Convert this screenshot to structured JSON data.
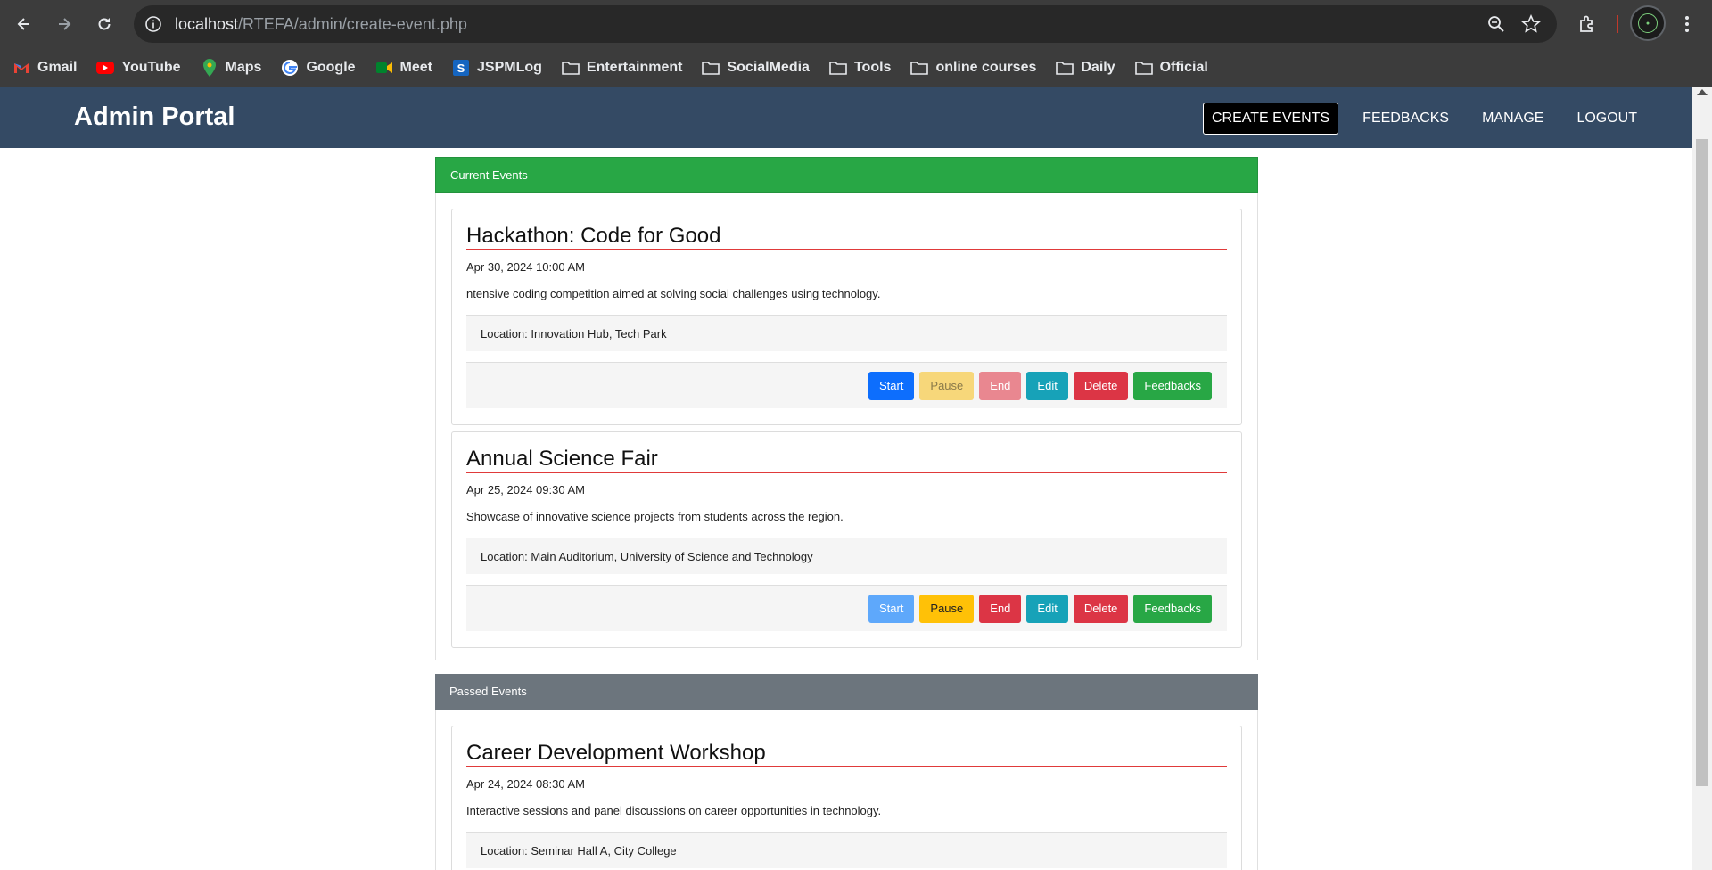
{
  "browser": {
    "url_host": "localhost",
    "url_path": "/RTEFA/admin/create-event.php",
    "bookmarks": [
      {
        "label": "Gmail",
        "icon": "gmail-icon"
      },
      {
        "label": "YouTube",
        "icon": "youtube-icon"
      },
      {
        "label": "Maps",
        "icon": "maps-icon"
      },
      {
        "label": "Google",
        "icon": "google-icon"
      },
      {
        "label": "Meet",
        "icon": "meet-icon"
      },
      {
        "label": "JSPMLog",
        "icon": "jspm-icon"
      },
      {
        "label": "Entertainment",
        "icon": "folder-icon"
      },
      {
        "label": "SocialMedia",
        "icon": "folder-icon"
      },
      {
        "label": "Tools",
        "icon": "folder-icon"
      },
      {
        "label": "online courses",
        "icon": "folder-icon"
      },
      {
        "label": "Daily",
        "icon": "folder-icon"
      },
      {
        "label": "Official",
        "icon": "folder-icon"
      }
    ]
  },
  "navbar": {
    "brand": "Admin Portal",
    "links": [
      "CREATE EVENTS",
      "FEEDBACKS",
      "MANAGE",
      "LOGOUT"
    ]
  },
  "current": {
    "header": "Current Events",
    "events": [
      {
        "title": "Hackathon: Code for Good",
        "date": "Apr 30, 2024 10:00 AM",
        "description": "ntensive coding competition aimed at solving social challenges using technology.",
        "location": "Location: Innovation Hub, Tech Park"
      },
      {
        "title": "Annual Science Fair",
        "date": "Apr 25, 2024 09:30 AM",
        "description": "Showcase of innovative science projects from students across the region.",
        "location": "Location: Main Auditorium, University of Science and Technology"
      }
    ]
  },
  "passed": {
    "header": "Passed Events",
    "events": [
      {
        "title": "Career Development Workshop",
        "date": "Apr 24, 2024 08:30 AM",
        "description": "Interactive sessions and panel discussions on career opportunities in technology.",
        "location": "Location: Seminar Hall A, City College"
      }
    ]
  },
  "buttons": {
    "start": "Start",
    "pause": "Pause",
    "end": "End",
    "edit": "Edit",
    "delete": "Delete",
    "feedbacks": "Feedbacks"
  },
  "colors": {
    "navbar": "#344a64",
    "current_header": "#28a745",
    "passed_header": "#6c757d",
    "title_underline": "#e03a3a"
  }
}
